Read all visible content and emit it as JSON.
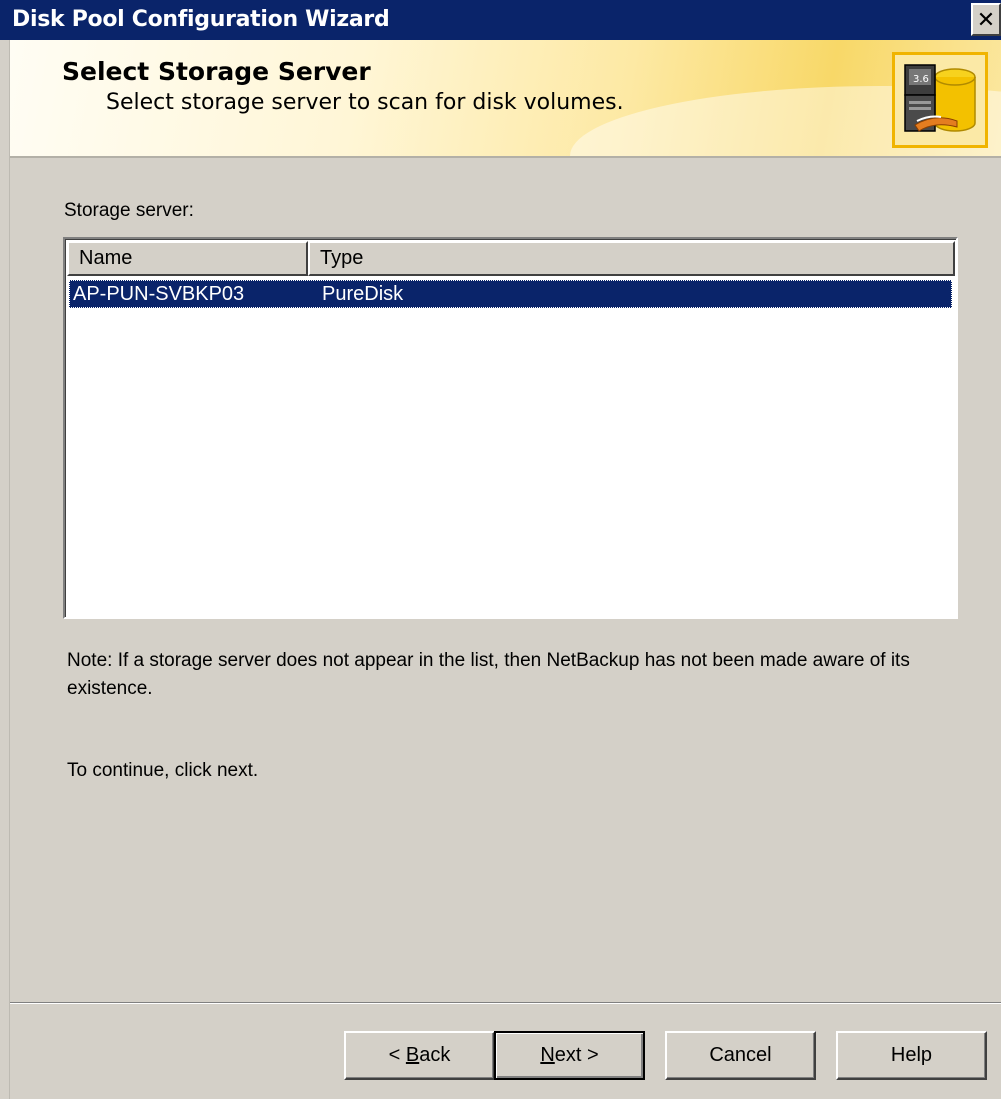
{
  "window": {
    "title": "Disk Pool Configuration Wizard",
    "close_label": "✕"
  },
  "header": {
    "title": "Select Storage Server",
    "subtitle": "Select storage server to scan for disk volumes."
  },
  "storage_server": {
    "label": "Storage server:",
    "columns": [
      "Name",
      "Type"
    ],
    "rows": [
      {
        "name": "AP-PUN-SVBKP03",
        "type": "PureDisk",
        "selected": true
      }
    ]
  },
  "note": "Note: If a storage server does not appear in the list, then NetBackup has not been made aware of its existence.",
  "continue_text": "To continue, click next.",
  "buttons": {
    "back": {
      "prefix": "< ",
      "mnemonic": "B",
      "rest": "ack"
    },
    "next": {
      "mnemonic": "N",
      "rest": "ext >"
    },
    "cancel": "Cancel",
    "help": "Help"
  },
  "colors": {
    "title_bar": "#0a246a",
    "selection": "#0a246a",
    "dialog_face": "#d4d0c8"
  }
}
